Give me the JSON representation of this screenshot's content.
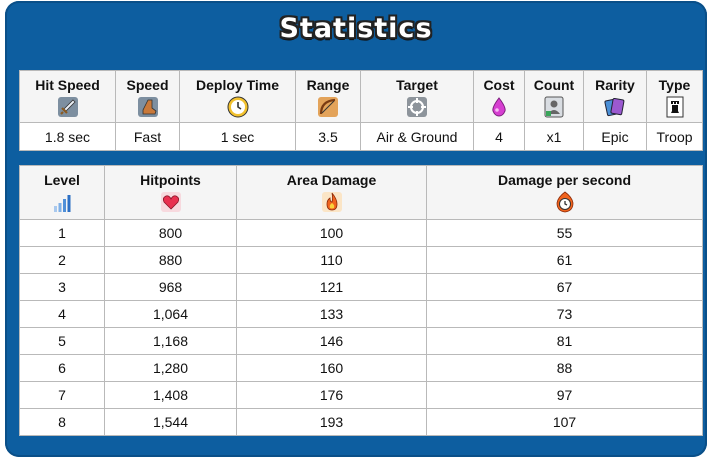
{
  "title": "Statistics",
  "stats": {
    "headers": [
      "Hit Speed",
      "Speed",
      "Deploy Time",
      "Range",
      "Target",
      "Cost",
      "Count",
      "Rarity",
      "Type"
    ],
    "icons": [
      "sword-icon",
      "boot-icon",
      "clock-icon",
      "bow-icon",
      "crosshair-icon",
      "elixir-drop-icon",
      "card-count-icon",
      "cards-icon",
      "rook-icon"
    ],
    "values": [
      "1.8 sec",
      "Fast",
      "1 sec",
      "3.5",
      "Air & Ground",
      "4",
      "x1",
      "Epic",
      "Troop"
    ]
  },
  "levels": {
    "headers": [
      "Level",
      "Hitpoints",
      "Area Damage",
      "Damage per second"
    ],
    "icons": [
      "level-bars-icon",
      "heart-icon",
      "fire-icon",
      "burning-clock-icon"
    ],
    "rows": [
      [
        "1",
        "800",
        "100",
        "55"
      ],
      [
        "2",
        "880",
        "110",
        "61"
      ],
      [
        "3",
        "968",
        "121",
        "67"
      ],
      [
        "4",
        "1,064",
        "133",
        "73"
      ],
      [
        "5",
        "1,168",
        "146",
        "81"
      ],
      [
        "6",
        "1,280",
        "160",
        "88"
      ],
      [
        "7",
        "1,408",
        "176",
        "97"
      ],
      [
        "8",
        "1,544",
        "193",
        "107"
      ]
    ]
  },
  "colors": {
    "panel": "#0d5ea0",
    "heart": "#e8304f",
    "elixir": "#d63fd1"
  }
}
